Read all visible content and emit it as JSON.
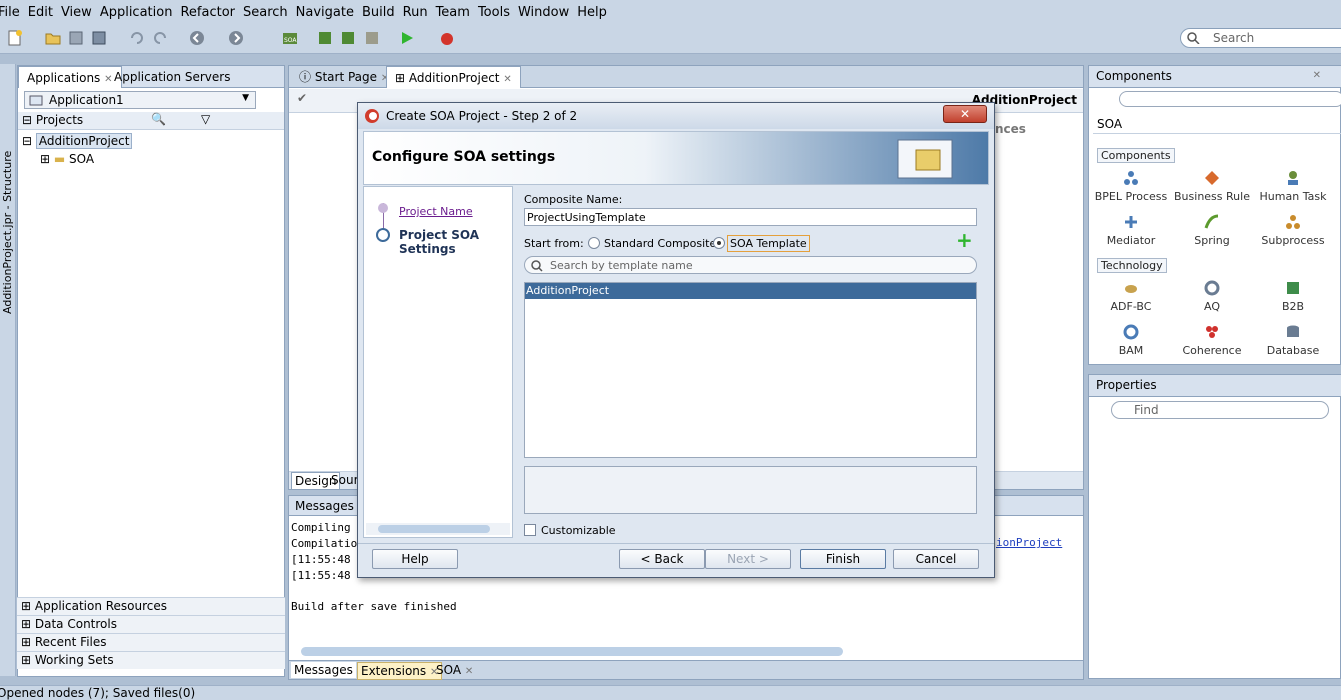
{
  "menu": [
    "File",
    "Edit",
    "View",
    "Application",
    "Refactor",
    "Search",
    "Navigate",
    "Build",
    "Run",
    "Team",
    "Tools",
    "Window",
    "Help"
  ],
  "search": {
    "placeholder": "Search"
  },
  "left": {
    "tabs": [
      "Applications",
      "Application Servers"
    ],
    "app_selector": "Application1",
    "projects_label": "Projects",
    "tree": [
      {
        "label": "AdditionProject"
      },
      {
        "label": "SOA"
      }
    ],
    "sections": [
      "Application Resources",
      "Data Controls",
      "Recent Files",
      "Working Sets"
    ],
    "vertical_label": "AdditionProject.jpr - Structure"
  },
  "editor": {
    "tabs": [
      "Start Page",
      "AdditionProject"
    ],
    "title": "AdditionProject",
    "bg_fragment": "nces",
    "bottom_tabs": [
      "Design",
      "Sour"
    ]
  },
  "messages": {
    "header": "Messages -",
    "lines": [
      "Compiling",
      "Compilatio",
      "[11:55:48",
      "[11:55:48"
    ],
    "link_fragment": "ionProject",
    "build_line": "Build after save finished",
    "tabs": [
      "Messages",
      "Extensions",
      "SOA"
    ]
  },
  "components": {
    "title": "Components",
    "filter": "SOA",
    "group1": "Components",
    "items1": [
      "BPEL Process",
      "Business Rule",
      "Human Task",
      "Mediator",
      "Spring",
      "Subprocess"
    ],
    "group2": "Technology",
    "items2": [
      "ADF-BC",
      "AQ",
      "B2B",
      "BAM",
      "Coherence",
      "Database"
    ]
  },
  "properties": {
    "title": "Properties",
    "find_placeholder": "Find"
  },
  "status": {
    "text": "Opened nodes (7); Saved files(0)"
  },
  "dialog": {
    "title": "Create SOA Project - Step 2 of 2",
    "header": "Configure SOA settings",
    "steps": [
      "Project Name",
      "Project SOA Settings"
    ],
    "composite_label": "Composite Name:",
    "composite_value": "ProjectUsingTemplate",
    "start_from": "Start from:",
    "radio_standard": "Standard Composite",
    "radio_template": "SOA Template",
    "template_search_placeholder": "Search by template name",
    "templates": [
      "AdditionProject"
    ],
    "customizable": "Customizable",
    "buttons": {
      "help": "Help",
      "back": "< Back",
      "next": "Next >",
      "finish": "Finish",
      "cancel": "Cancel"
    }
  },
  "colors": {
    "selection": "#3d6a9a",
    "accent_green": "#2fb52f",
    "link_purple": "#6b1c8e"
  }
}
